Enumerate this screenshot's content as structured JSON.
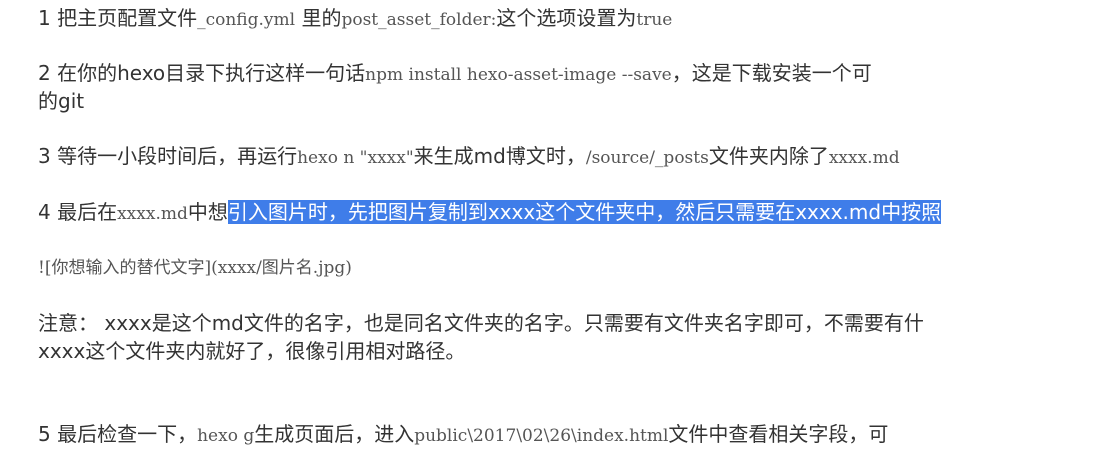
{
  "doc": {
    "step1": {
      "a": "1 把主页配置文件",
      "code1": "_config.yml",
      "b": " 里的",
      "code2": "post_asset_folder:",
      "c": "这个选项设置为",
      "code3": "true"
    },
    "step2": {
      "a": "2 在你的hexo目录下执行这样一句话",
      "code1": "npm install hexo-asset-image --save",
      "b": "，这是下载安装一个可",
      "cont": "的git"
    },
    "step3": {
      "a": "3 等待一小段时间后，再运行",
      "code1": "hexo n \"xxxx\"",
      "b": "来生成md博文时，",
      "code2": "/source/_posts",
      "c": "文件夹内除了",
      "code3": "xxxx.md"
    },
    "step4": {
      "a": "4 最后在",
      "code1": "xxxx.md",
      "b": "中想",
      "selected": "引入图片时，先把图片复制到xxxx这个文件夹中，然后只需要在xxxx.md中按照"
    },
    "code_example": "![你想输入的替代文字](xxxx/图片名.jpg)",
    "note": {
      "line1": "注意： xxxx是这个md文件的名字，也是同名文件夹的名字。只需要有文件夹名字即可，不需要有什",
      "line2": "xxxx这个文件夹内就好了，很像引用相对路径。"
    },
    "step5": {
      "a": "5 最后检查一下，",
      "code1": "hexo g",
      "b": "生成页面后，进入",
      "code2": "public\\2017\\02\\26\\index.html",
      "c": "文件中查看相关字段，可"
    }
  }
}
